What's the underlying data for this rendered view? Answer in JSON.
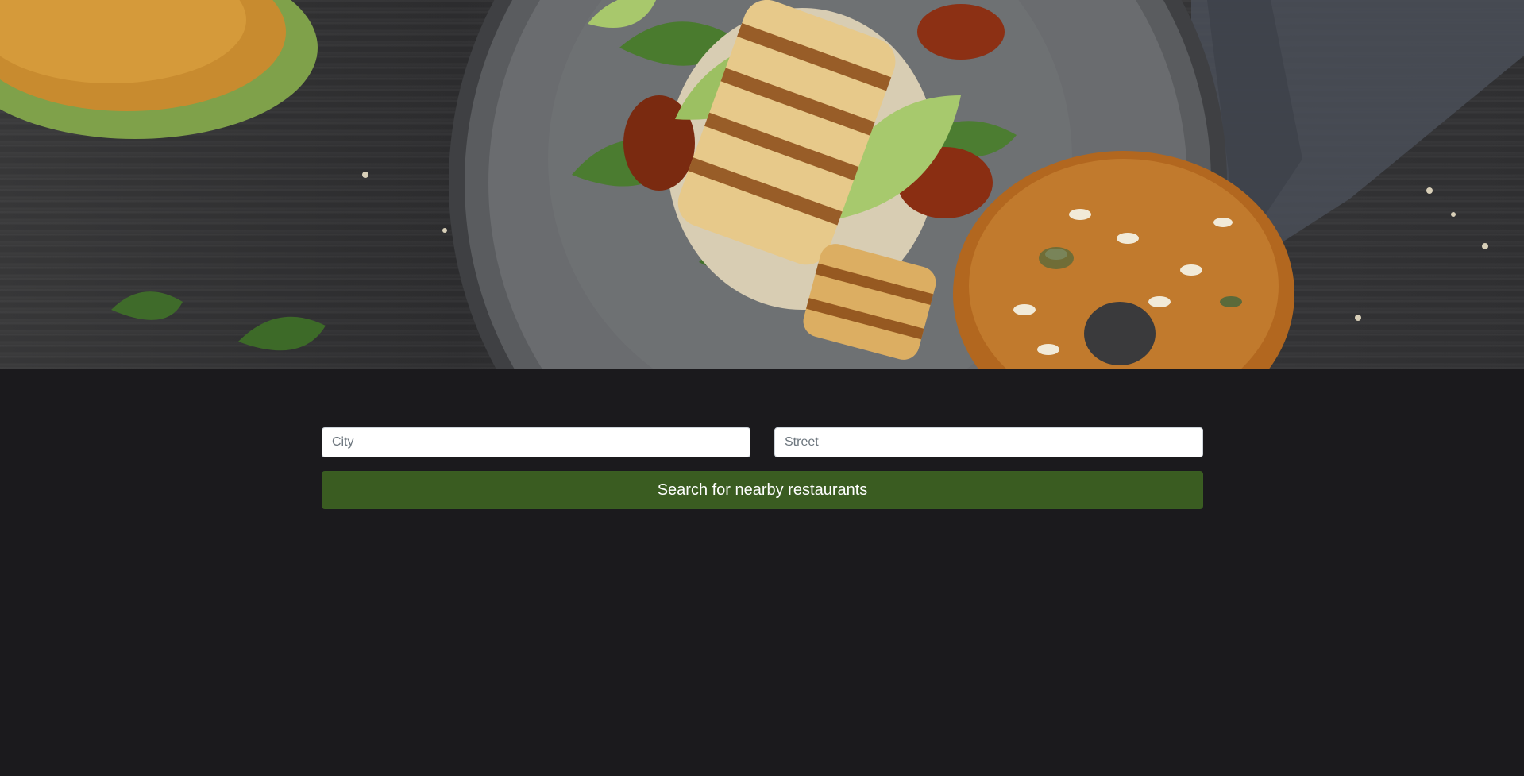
{
  "hero": {
    "image_subject": "grilled halloumi and avocado bagel sandwich on a dark plate with a seeded bagel on wooden table"
  },
  "search": {
    "city_placeholder": "City",
    "city_value": "",
    "street_placeholder": "Street",
    "street_value": "",
    "button_label": "Search for nearby restaurants"
  },
  "colors": {
    "page_background": "#1b1a1d",
    "button_background": "#3a5c21",
    "button_text": "#ffffff",
    "input_background": "#ffffff"
  }
}
